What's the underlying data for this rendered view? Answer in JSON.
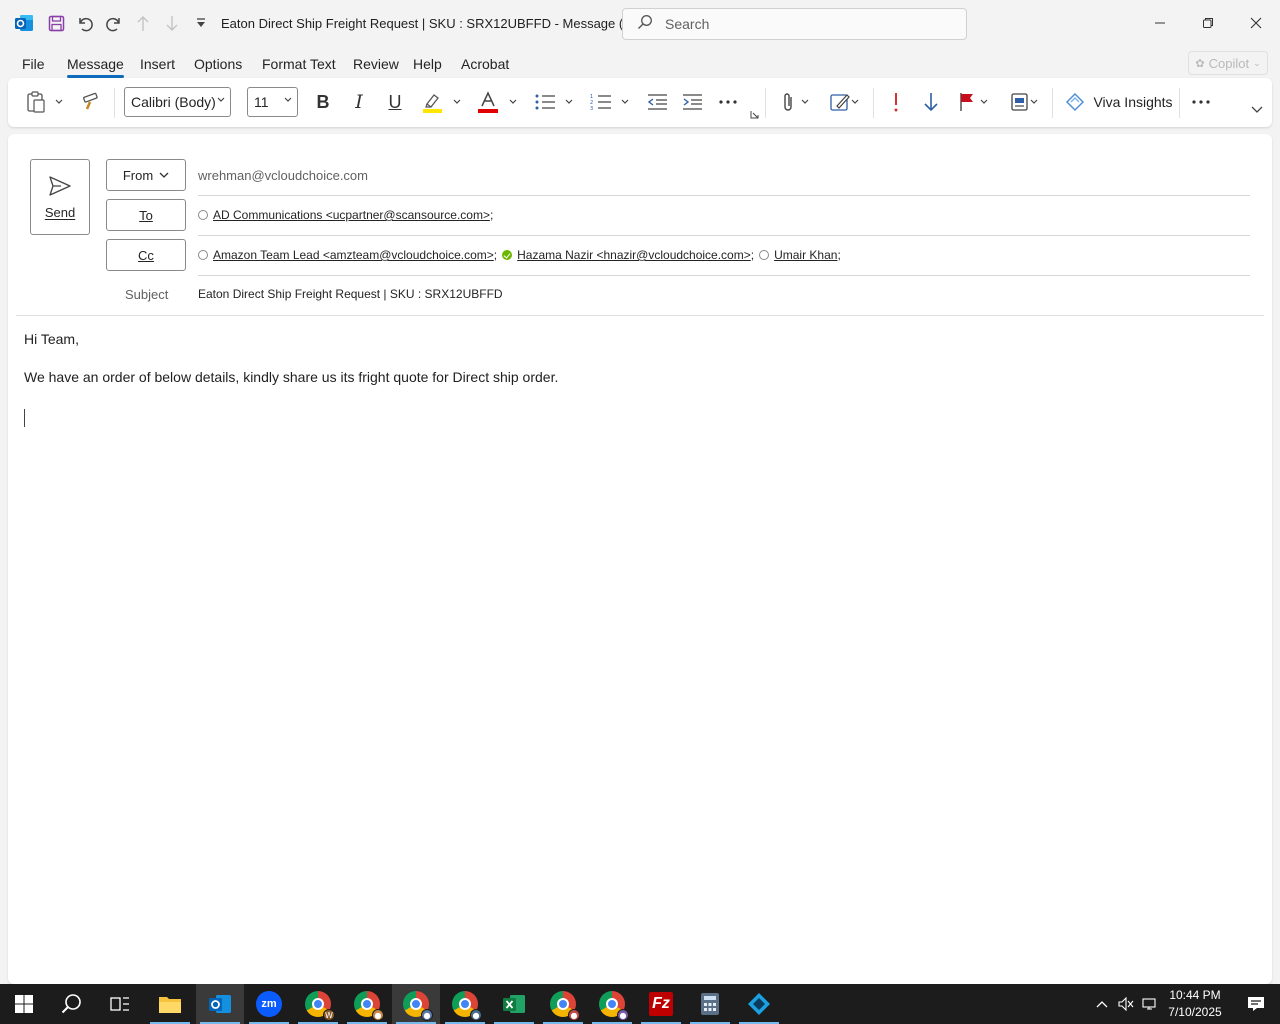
{
  "window": {
    "title": "Eaton Direct Ship Freight Request | SKU : SRX12UBFFD  -  Message (HT...",
    "search_placeholder": "Search"
  },
  "menu": {
    "tabs": [
      "File",
      "Message",
      "Insert",
      "Options",
      "Format Text",
      "Review",
      "Help",
      "Acrobat"
    ],
    "active": "Message",
    "copilot_label": "Copilot"
  },
  "ribbon": {
    "font_name": "Calibri (Body)",
    "font_size": "11",
    "viva_insights_label": "Viva Insights",
    "colors": {
      "highlight": "#ffe600",
      "font_color": "#e00000",
      "importance_high": "#d13438",
      "flag": "#c50f1f"
    }
  },
  "compose": {
    "send_label": "Send",
    "from_label": "From",
    "from_value": "wrehman@vcloudchoice.com",
    "to_label": "To",
    "to_recipients": [
      {
        "text": "AD Communications <ucpartner@scansource.com>",
        "presence": "unknown"
      }
    ],
    "cc_label": "Cc",
    "cc_recipients": [
      {
        "text": "Amazon Team Lead <amzteam@vcloudchoice.com>",
        "presence": "unknown"
      },
      {
        "text": "Hazama Nazir <hnazir@vcloudchoice.com>",
        "presence": "available"
      },
      {
        "text": "Umair Khan",
        "presence": "unknown"
      }
    ],
    "subject_label": "Subject",
    "subject_value": "Eaton Direct Ship Freight Request | SKU : SRX12UBFFD",
    "body": {
      "greeting": "Hi Team,",
      "line1": "We have an order of below details, kindly share us its fright quote for Direct ship order."
    }
  },
  "taskbar": {
    "time": "10:44 PM",
    "date": "7/10/2025",
    "zoom_label": "zm"
  }
}
